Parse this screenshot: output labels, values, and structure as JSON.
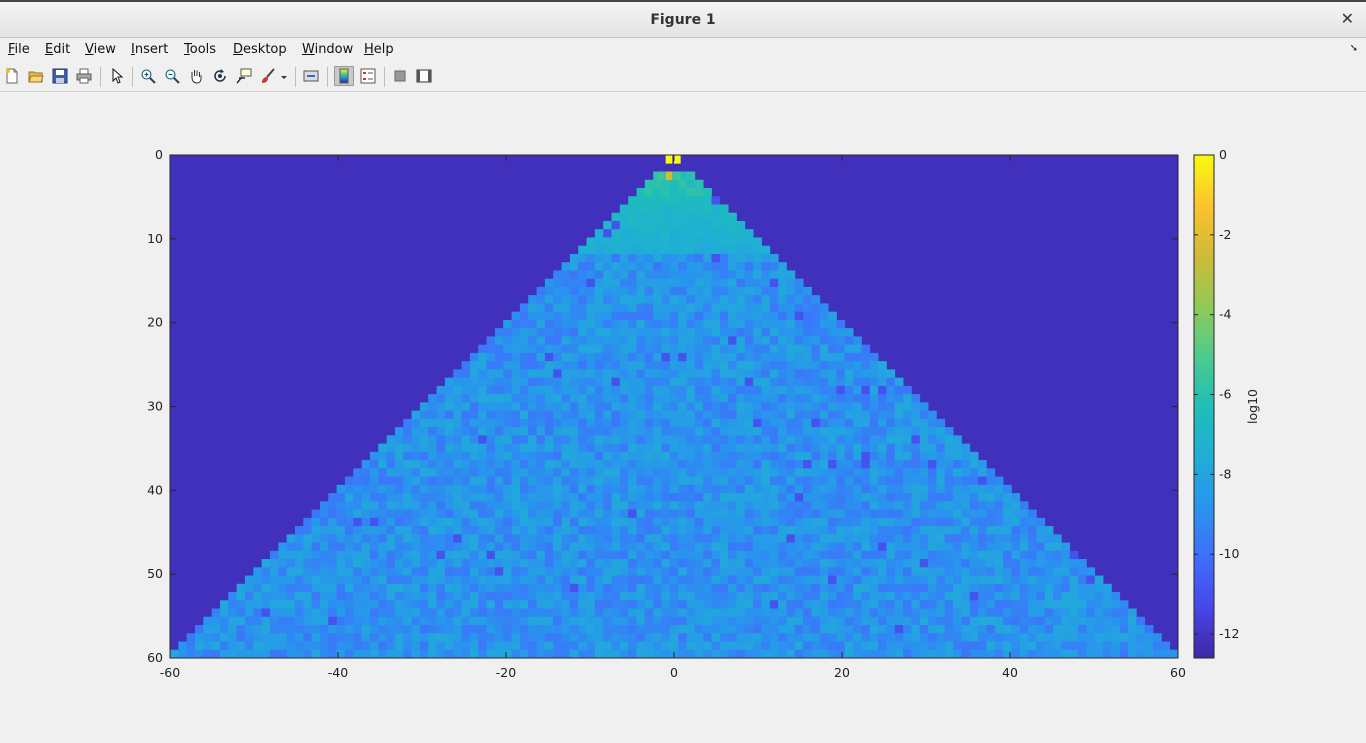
{
  "window": {
    "title": "Figure 1",
    "close_icon": "close-icon"
  },
  "menu": {
    "items": [
      {
        "mnemonic": "F",
        "rest": "ile"
      },
      {
        "mnemonic": "E",
        "rest": "dit"
      },
      {
        "mnemonic": "V",
        "rest": "iew"
      },
      {
        "mnemonic": "I",
        "rest": "nsert"
      },
      {
        "mnemonic": "T",
        "rest": "ools"
      },
      {
        "mnemonic": "D",
        "rest": "esktop"
      },
      {
        "mnemonic": "W",
        "rest": "indow"
      },
      {
        "mnemonic": "H",
        "rest": "elp"
      }
    ]
  },
  "toolbar": {
    "icons": [
      "new-figure-icon",
      "open-file-icon",
      "save-icon",
      "print-icon",
      "edit-plot-arrow-icon",
      "zoom-in-icon",
      "zoom-out-icon",
      "pan-hand-icon",
      "rotate-3d-icon",
      "data-cursor-icon",
      "brush-icon",
      "brush-dropdown-icon",
      "link-plot-icon",
      "colorbar-toggle-icon",
      "legend-toggle-icon",
      "hide-plot-tools-icon",
      "show-plot-tools-icon"
    ]
  },
  "chart_data": {
    "type": "heatmap",
    "title": "",
    "xlabel": "",
    "ylabel": "",
    "x_ticks": [
      -60,
      -40,
      -20,
      0,
      20,
      40,
      60
    ],
    "y_ticks": [
      0,
      10,
      20,
      30,
      40,
      50,
      60
    ],
    "xlim": [
      -60,
      60
    ],
    "ylim": [
      0,
      60
    ],
    "y_direction": "reversed",
    "colormap": "parula",
    "color_range": [
      -12.6,
      0
    ],
    "colorbar": {
      "ticks": [
        0,
        -2,
        -4,
        -6,
        -8,
        -10,
        -12
      ],
      "label": "log10"
    },
    "background_value": -12.2,
    "apex_value": 0,
    "near_apex_value": -6.2,
    "interior_value_range": [
      -9.8,
      -7.8
    ],
    "region": "triangle, |x| <= row index, rows 0 to 60"
  }
}
